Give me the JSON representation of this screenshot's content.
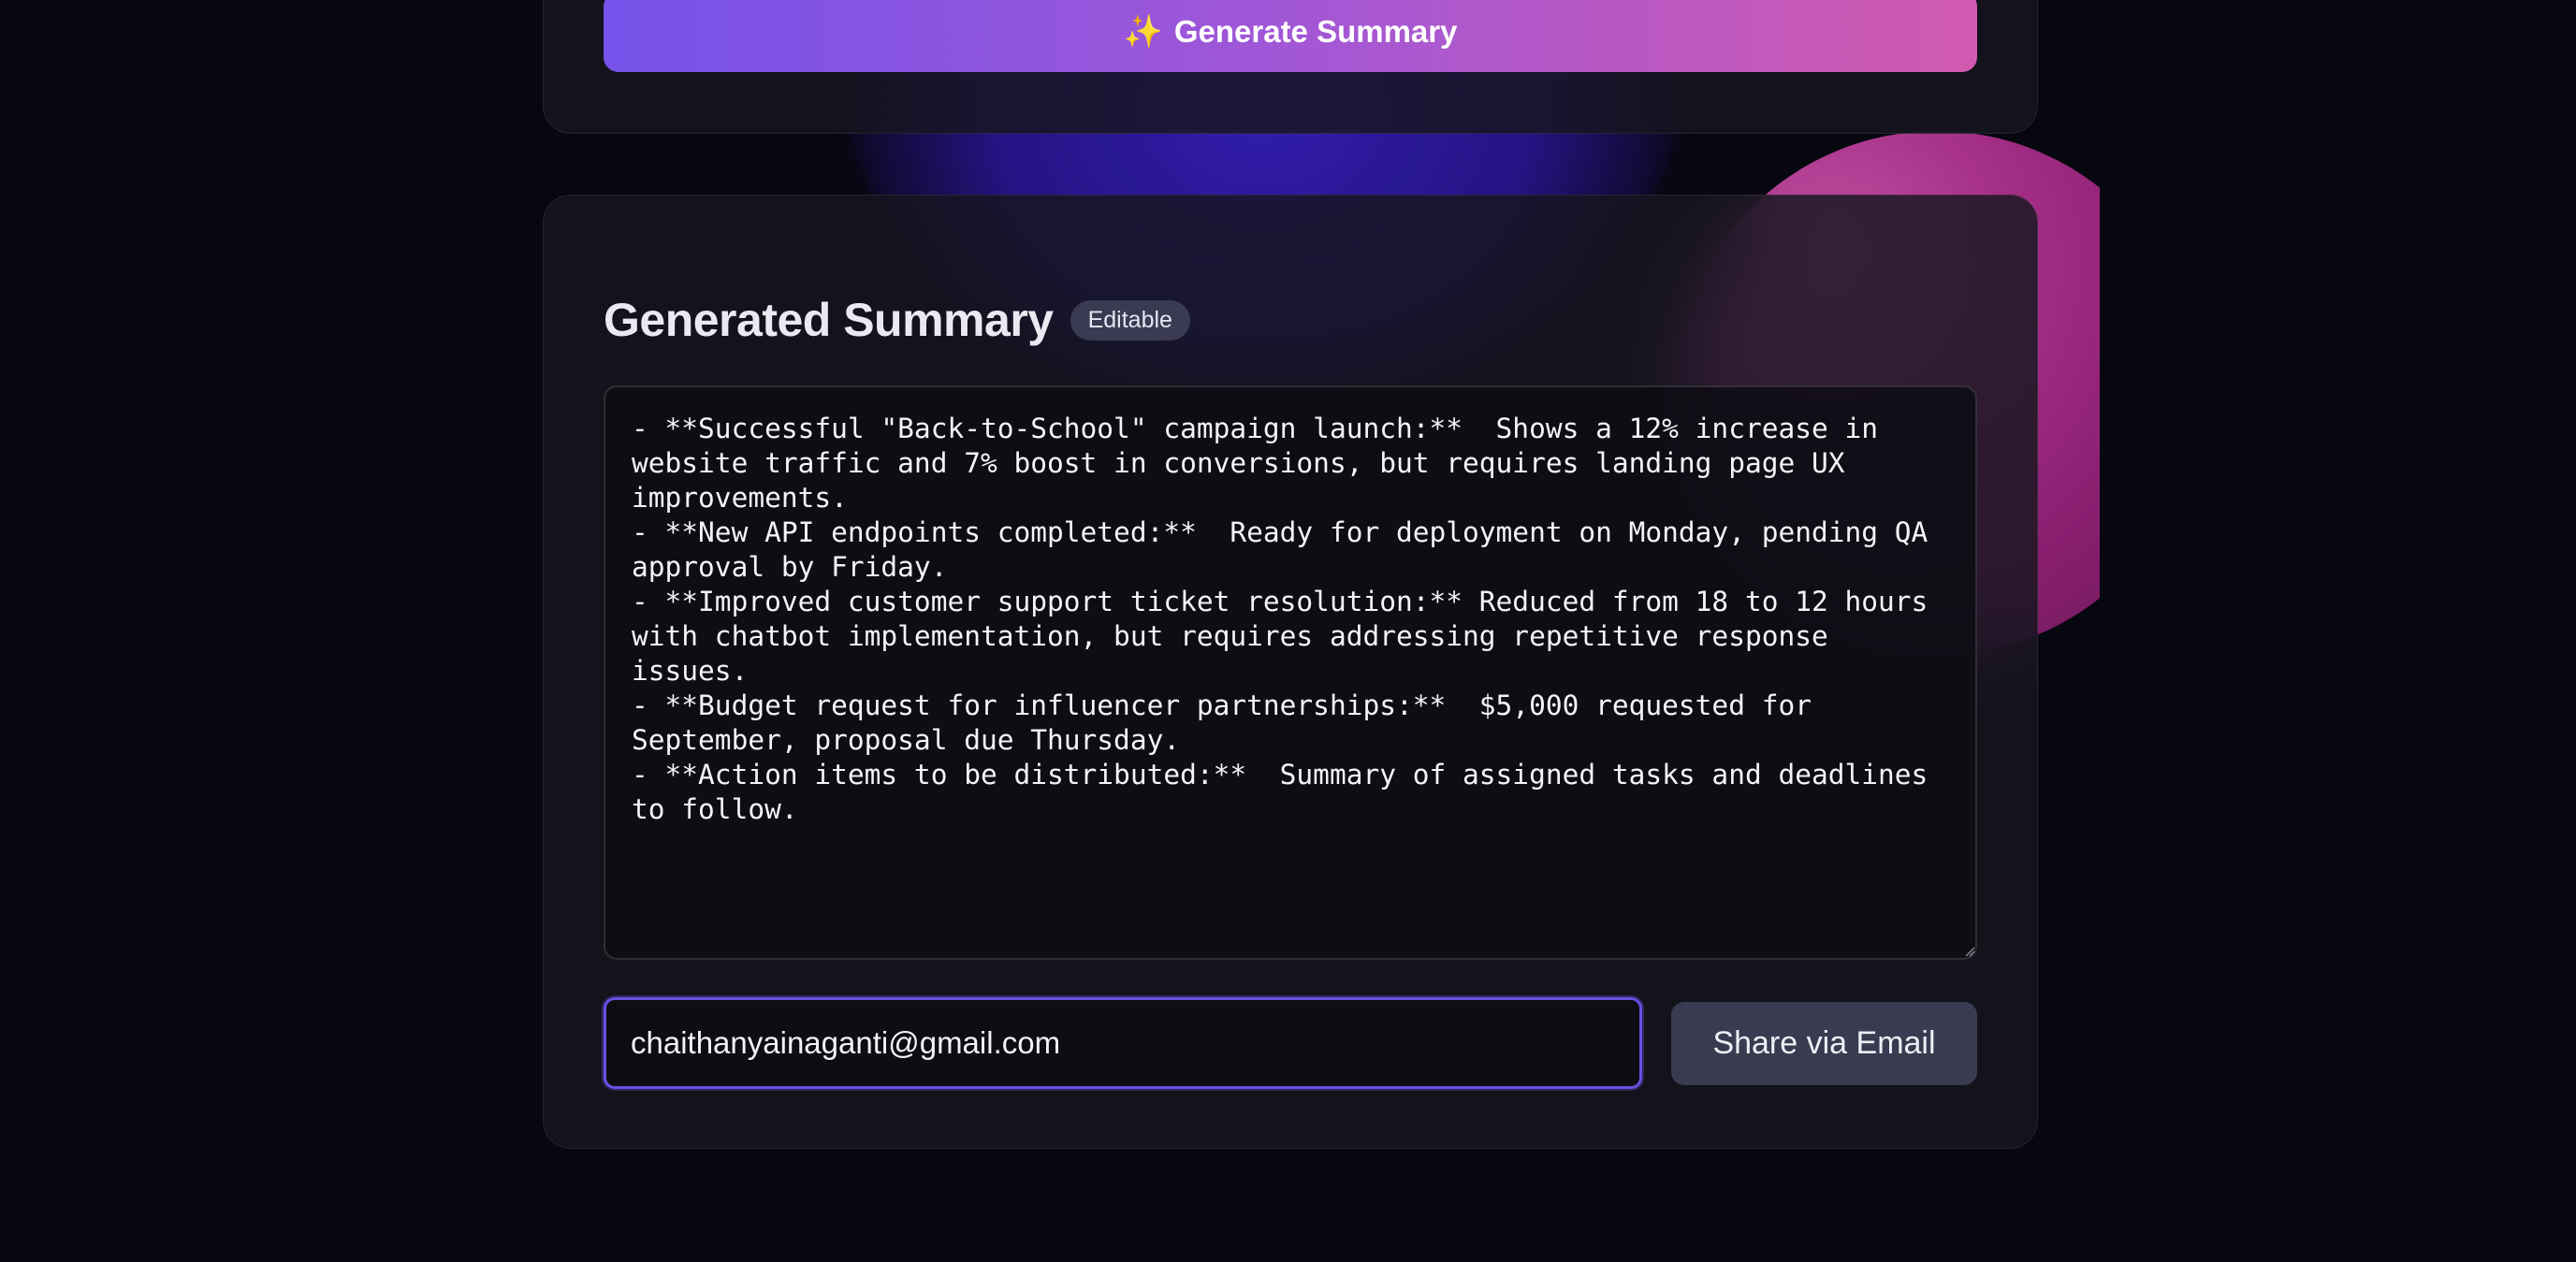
{
  "generate_panel": {
    "button_icon": "✨",
    "button_label": "Generate Summary"
  },
  "summary_panel": {
    "title": "Generated Summary",
    "badge": "Editable",
    "summary_text": "- **Successful \"Back-to-School\" campaign launch:**  Shows a 12% increase in website traffic and 7% boost in conversions, but requires landing page UX improvements.\n- **New API endpoints completed:**  Ready for deployment on Monday, pending QA approval by Friday.\n- **Improved customer support ticket resolution:** Reduced from 18 to 12 hours with chatbot implementation, but requires addressing repetitive response issues.\n- **Budget request for influencer partnerships:**  $5,000 requested for September, proposal due Thursday.\n- **Action items to be distributed:**  Summary of assigned tasks and deadlines to follow.",
    "email_value": "chaithanyainaganti@gmail.com",
    "share_label": "Share via Email"
  },
  "colors": {
    "background": "#07070f",
    "accent_start": "#7552ea",
    "accent_end": "#d15aaf",
    "focus_border": "#6a4fe0",
    "share_button": "#3a3b50"
  },
  "icons": {
    "generate": "sparkle-icon",
    "textarea_corner": "resize-handle-icon"
  }
}
